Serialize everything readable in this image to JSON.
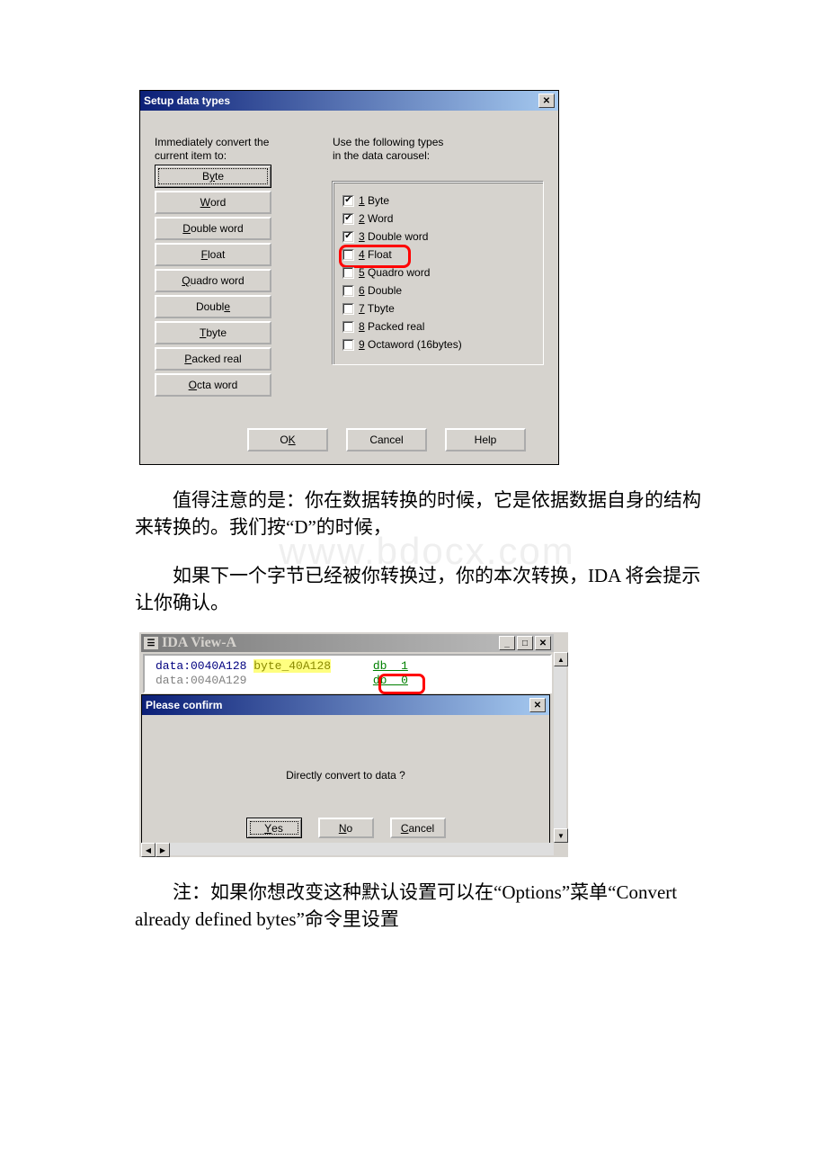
{
  "dialog1": {
    "title": "Setup data types",
    "label_left_line1": "Immediately convert the",
    "label_left_line2": "current item to:",
    "label_right_line1": "Use the following types",
    "label_right_line2": "in the data carousel:",
    "buttons": {
      "byte_pre": "B",
      "byte_u": "y",
      "byte_post": "te",
      "word_u": "W",
      "word_post": "ord",
      "dword_pre": "",
      "dword_u": "D",
      "dword_post": "ouble word",
      "float_u": "F",
      "float_post": "loat",
      "qword_u": "Q",
      "qword_post": "uadro word",
      "double_pre": "Doubl",
      "double_u": "e",
      "double_post": "",
      "tbyte_u": "T",
      "tbyte_post": "byte",
      "packed_u": "P",
      "packed_post": "acked real",
      "octa_u": "O",
      "octa_post": "cta word"
    },
    "checks": [
      {
        "u": "1",
        "label": " Byte",
        "checked": true,
        "highlight": false
      },
      {
        "u": "2",
        "label": " Word",
        "checked": true,
        "highlight": false
      },
      {
        "u": "3",
        "label": " Double word",
        "checked": true,
        "highlight": false
      },
      {
        "u": "4",
        "label": " Float",
        "checked": false,
        "highlight": true
      },
      {
        "u": "5",
        "label": " Quadro word",
        "checked": false,
        "highlight": false
      },
      {
        "u": "6",
        "label": " Double",
        "checked": false,
        "highlight": false
      },
      {
        "u": "7",
        "label": " Tbyte",
        "checked": false,
        "highlight": false
      },
      {
        "u": "8",
        "label": " Packed real",
        "checked": false,
        "highlight": false
      },
      {
        "u": "9",
        "label": " Octaword (16bytes)",
        "checked": false,
        "highlight": false
      }
    ],
    "ok_pre": "O",
    "ok_u": "K",
    "cancel": "Cancel",
    "help": "Help"
  },
  "para1": "值得注意的是：你在数据转换的时候，它是依据数据自身的结构来转换的。我们按“D”的时候，",
  "para2_a": "如果下一个字节已经被你转换过，你的本次转换，IDA 将会提示让你确认。",
  "para3": "注：如果你想改变这种默认设置可以在“Options”菜单“Convert already defined bytes”命令里设置",
  "ida": {
    "title": "IDA View-A",
    "line1_seg": "data:0040A128",
    "line1_label": "byte_40A128",
    "line1_val": "db  1",
    "line2_seg": "data:0040A129",
    "line2_val": "db  0"
  },
  "confirm": {
    "title": "Please confirm",
    "msg": "Directly convert to data ?",
    "yes_u": "Y",
    "yes_post": "es",
    "no_u": "N",
    "no_post": "o",
    "cancel_u": "C",
    "cancel_post": "ancel"
  },
  "watermark": "www.bdocx.com"
}
